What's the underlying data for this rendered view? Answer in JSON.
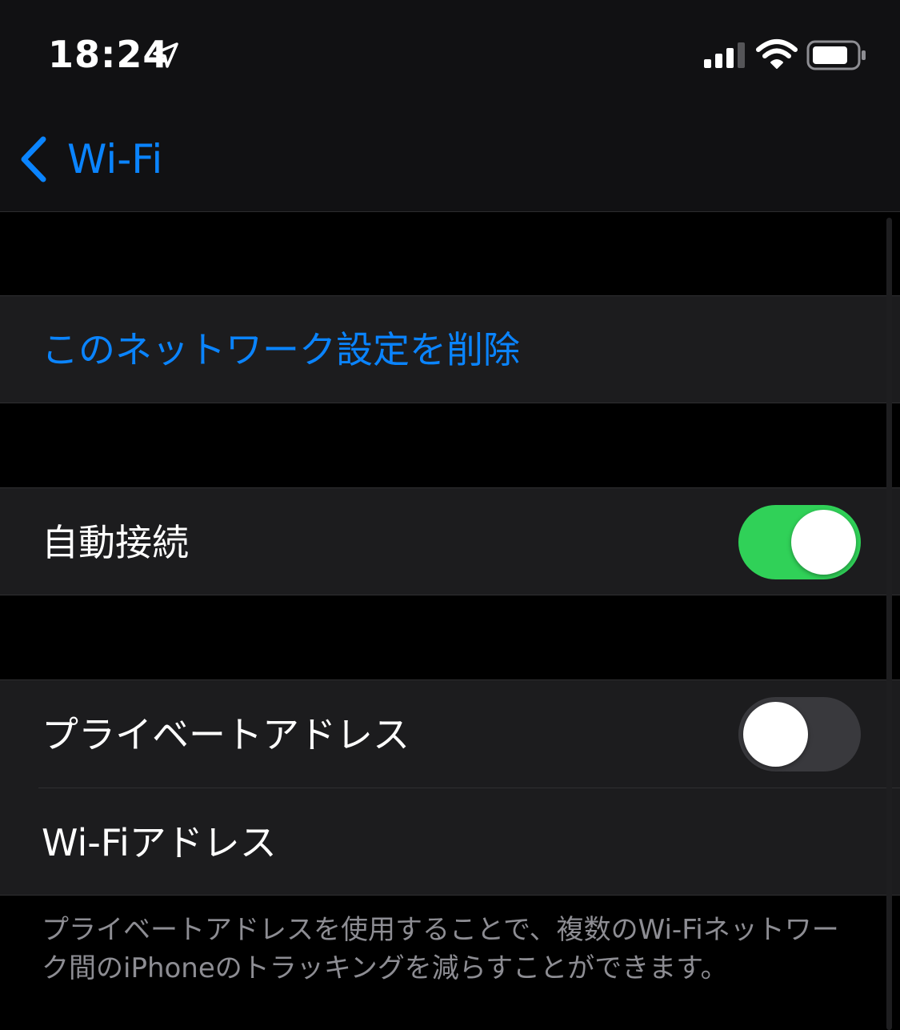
{
  "status_bar": {
    "time": "18:24",
    "icons": [
      "location-arrow-icon",
      "cellular-signal-icon",
      "wifi-icon",
      "battery-icon"
    ]
  },
  "nav": {
    "back_label": "Wi-Fi",
    "back_icon": "chevron-left-icon"
  },
  "sections": {
    "forget": {
      "label": "このネットワーク設定を削除"
    },
    "auto_join": {
      "label": "自動接続",
      "toggle_on": true
    },
    "private_address": {
      "label": "プライベートアドレス",
      "toggle_on": false
    },
    "wifi_address": {
      "label": "Wi-Fiアドレス"
    }
  },
  "footer": {
    "text": "プライベートアドレスを使用することで、複数のWi-Fiネットワーク間のiPhoneのトラッキングを減らすことができます。"
  },
  "colors": {
    "background": "#000000",
    "cell_background": "#1c1c1e",
    "accent_blue": "#0a84ff",
    "toggle_on_green": "#30d158",
    "toggle_off_gray": "#39393d",
    "footer_text": "#8d8d93"
  }
}
